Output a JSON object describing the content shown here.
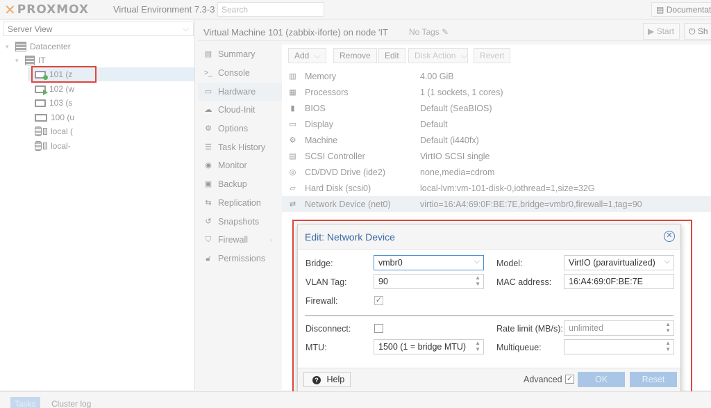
{
  "topbar": {
    "brand": "PROXMOX",
    "version": "Virtual Environment 7.3-3",
    "search_placeholder": "Search",
    "docs_label": "Documentation"
  },
  "tree": {
    "view": "Server View",
    "datacenter": "Datacenter",
    "node": "IT",
    "items": [
      {
        "label": "101 (z",
        "icon": "vm-monitor-icon"
      },
      {
        "label": "102 (w",
        "icon": "vm-monitor-icon"
      },
      {
        "label": "103 (s",
        "icon": "vm-monitor-icon"
      },
      {
        "label": "100 (u",
        "icon": "container-icon"
      },
      {
        "label": "local (",
        "icon": "storage-icon"
      },
      {
        "label": "local-",
        "icon": "storage-icon"
      }
    ]
  },
  "header": {
    "title": "Virtual Machine 101 (zabbix-iforte) on node 'IT",
    "tags": "No Tags",
    "start": "Start",
    "shutdown": "Sh"
  },
  "nav": [
    {
      "label": "Summary",
      "icon": "book-icon"
    },
    {
      "label": "Console",
      "icon": "terminal-icon"
    },
    {
      "label": "Hardware",
      "icon": "desktop-icon"
    },
    {
      "label": "Cloud-Init",
      "icon": "cloud-icon"
    },
    {
      "label": "Options",
      "icon": "gear-icon"
    },
    {
      "label": "Task History",
      "icon": "list-icon"
    },
    {
      "label": "Monitor",
      "icon": "eye-icon"
    },
    {
      "label": "Backup",
      "icon": "floppy-icon"
    },
    {
      "label": "Replication",
      "icon": "retweet-icon"
    },
    {
      "label": "Snapshots",
      "icon": "history-icon"
    },
    {
      "label": "Firewall",
      "icon": "shield-icon"
    },
    {
      "label": "Permissions",
      "icon": "unlock-icon"
    }
  ],
  "toolbar": {
    "add": "Add",
    "remove": "Remove",
    "edit": "Edit",
    "disk_action": "Disk Action",
    "revert": "Revert"
  },
  "hardware": [
    {
      "name": "Memory",
      "value": "4.00 GiB",
      "icon": "memory-icon"
    },
    {
      "name": "Processors",
      "value": "1 (1 sockets, 1 cores)",
      "icon": "cpu-icon"
    },
    {
      "name": "BIOS",
      "value": "Default (SeaBIOS)",
      "icon": "bios-icon"
    },
    {
      "name": "Display",
      "value": "Default",
      "icon": "display-icon"
    },
    {
      "name": "Machine",
      "value": "Default (i440fx)",
      "icon": "cogs-icon"
    },
    {
      "name": "SCSI Controller",
      "value": "VirtIO SCSI single",
      "icon": "database-icon"
    },
    {
      "name": "CD/DVD Drive (ide2)",
      "value": "none,media=cdrom",
      "icon": "cdrom-icon"
    },
    {
      "name": "Hard Disk (scsi0)",
      "value": "local-lvm:vm-101-disk-0,iothread=1,size=32G",
      "icon": "hdd-icon"
    },
    {
      "name": "Network Device (net0)",
      "value": "virtio=16:A4:69:0F:BE:7E,bridge=vmbr0,firewall=1,tag=90",
      "icon": "exchange-icon"
    }
  ],
  "dialog": {
    "title": "Edit: Network Device",
    "bridge_label": "Bridge:",
    "bridge_value": "vmbr0",
    "vlan_label": "VLAN Tag:",
    "vlan_value": "90",
    "firewall_label": "Firewall:",
    "model_label": "Model:",
    "model_value": "VirtIO (paravirtualized)",
    "mac_label": "MAC address:",
    "mac_value": "16:A4:69:0F:BE:7E",
    "disconnect_label": "Disconnect:",
    "mtu_label": "MTU:",
    "mtu_value": "1500 (1 = bridge MTU)",
    "rate_label": "Rate limit (MB/s):",
    "rate_placeholder": "unlimited",
    "multiqueue_label": "Multiqueue:",
    "help": "Help",
    "advanced": "Advanced",
    "ok": "OK",
    "reset": "Reset"
  },
  "bottom": {
    "tasks": "Tasks",
    "cluster_log": "Cluster log"
  },
  "colors": {
    "accent": "#3a6aa5",
    "highlight": "#e0453b",
    "brand_orange": "#e57000"
  }
}
